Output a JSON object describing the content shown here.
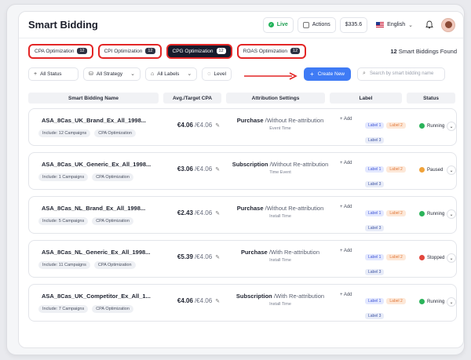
{
  "header": {
    "title": "Smart Bidding",
    "live_label": "Live",
    "actions_label": "Actions",
    "balance": "$335.6",
    "language": "English"
  },
  "tabs": [
    {
      "label": "CPA Optimization",
      "count": "12"
    },
    {
      "label": "CPI Optimization",
      "count": "12"
    },
    {
      "label": "CPG Optimization",
      "count": "12"
    },
    {
      "label": "ROAS Optimization",
      "count": "12"
    }
  ],
  "found": {
    "count": "12",
    "label": "Smart Biddings Found"
  },
  "filters": {
    "status": "All Status",
    "strategy": "All Strategy",
    "labels": "All Labels",
    "level": "Level",
    "create_label": "Create New",
    "search_placeholder": "Search by smart bidding name"
  },
  "columns": [
    "Smart Bidding Name",
    "Avg./Target CPA",
    "Attribution Settings",
    "Label",
    "Status"
  ],
  "rows": [
    {
      "name": "ASA_8Cas_UK_Brand_Ex_All_1998...",
      "include": "Include: 12 Campaigns",
      "strategy": "CPA Optimization",
      "avg": "€4.06",
      "target": "/€4.06",
      "event": "Purchase",
      "attribution": "/Without Re-attribution",
      "sub": "Event Time",
      "add": "+ Add",
      "label1": "Label 1",
      "label2": "Label 2",
      "label3": "Label 3",
      "status": "Running",
      "status_color": "#2bb35a"
    },
    {
      "name": "ASA_8Cas_UK_Generic_Ex_All_1998...",
      "include": "Include: 1 Campaigns",
      "strategy": "CPA Optimization",
      "avg": "€3.06",
      "target": "/€4.06",
      "event": "Subscription",
      "attribution": "/Without Re-attribution",
      "sub": "Time Event",
      "add": "+ Add",
      "label1": "Label 1",
      "label2": "Label 2",
      "label3": "Label 3",
      "status": "Paused",
      "status_color": "#f0a23a"
    },
    {
      "name": "ASA_8Cas_NL_Brand_Ex_All_1998...",
      "include": "Include: 5 Campaigns",
      "strategy": "CPA Optimization",
      "avg": "€2.43",
      "target": "/€4.06",
      "event": "Purchase",
      "attribution": "/Without Re-attribution",
      "sub": "Install Time",
      "add": "+ Add",
      "label1": "Label 1",
      "label2": "Label 2",
      "label3": "Label 3",
      "status": "Running",
      "status_color": "#2bb35a"
    },
    {
      "name": "ASA_8Cas_NL_Generic_Ex_All_1998...",
      "include": "Include: 11 Campaigns",
      "strategy": "CPA Optimization",
      "avg": "€5.39",
      "target": "/€4.06",
      "event": "Purchase",
      "attribution": "/With Re-attribution",
      "sub": "Install Time",
      "add": "+ Add",
      "label1": "Label 1",
      "label2": "Label 2",
      "label3": "Label 3",
      "status": "Stopped",
      "status_color": "#e2463c"
    },
    {
      "name": "ASA_8Cas_UK_Competitor_Ex_All_1...",
      "include": "Include: 7 Campaigns",
      "strategy": "CPA Optimization",
      "avg": "€4.06",
      "target": "/€4.06",
      "event": "Subscription",
      "attribution": "/With Re-attribution",
      "sub": "Install Time",
      "add": "+ Add",
      "label1": "Label 1",
      "label2": "Label 2",
      "label3": "Label 3",
      "status": "Running",
      "status_color": "#2bb35a"
    }
  ],
  "colors": {
    "accent": "#3f7bf5",
    "highlight": "#e32626",
    "dark_tab": "#171b2c"
  }
}
